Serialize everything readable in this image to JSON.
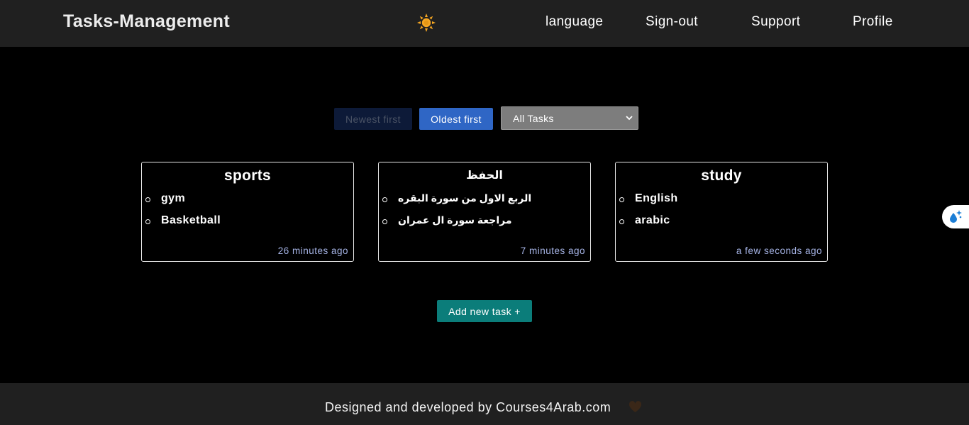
{
  "header": {
    "brand": "Tasks-Management",
    "theme_icon": "sun-icon",
    "nav": {
      "language": "language",
      "signout": "Sign-out",
      "support": "Support",
      "profile": "Profile"
    }
  },
  "toolbar": {
    "newest_label": "Newest first",
    "oldest_label": "Oldest first",
    "filter_selected": "All Tasks",
    "filter_icon": "chevron-down-icon"
  },
  "tasks": [
    {
      "title": "sports",
      "items": [
        "gym",
        "Basketball"
      ],
      "time": "26 minutes ago"
    },
    {
      "title": "الحفظ",
      "items": [
        "الربع الاول من سورة البقره",
        "مراجعة سورة ال عمران"
      ],
      "time": "7 minutes ago"
    },
    {
      "title": "study",
      "items": [
        "English",
        "arabic"
      ],
      "time": "a few seconds ago"
    }
  ],
  "actions": {
    "add_task": "Add new task +"
  },
  "side_widget_icon": "droplet-sparkle-icon",
  "footer": {
    "text": "Designed and developed by Courses4Arab.com",
    "heart_icon": "heart-icon"
  },
  "colors": {
    "header_bg": "#202020",
    "page_bg": "#000000",
    "newest_bg": "#0d1a38",
    "oldest_bg": "#2f66c5",
    "select_bg": "#7d7d7d",
    "add_bg": "#0b7d7a",
    "time_text": "#a6b4e6",
    "sun": "#f5a623"
  }
}
